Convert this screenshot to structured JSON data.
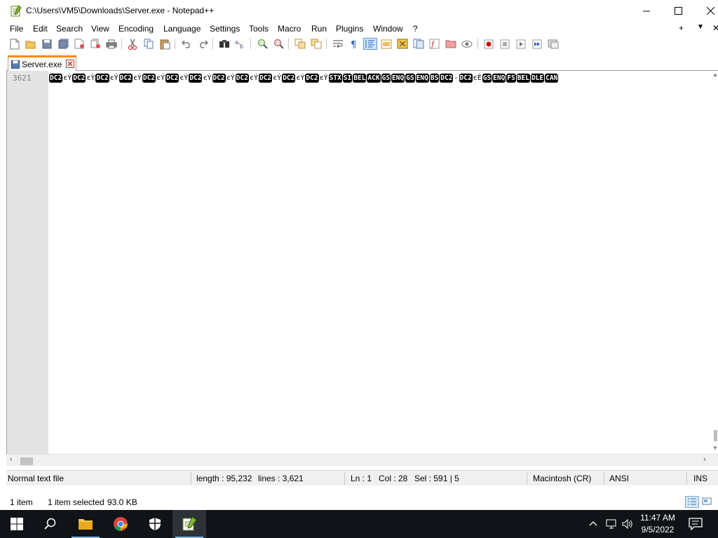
{
  "window": {
    "title": "C:\\Users\\VM5\\Downloads\\Server.exe - Notepad++"
  },
  "menu": {
    "items": [
      "File",
      "Edit",
      "Search",
      "View",
      "Encoding",
      "Language",
      "Settings",
      "Tools",
      "Macro",
      "Run",
      "Plugins",
      "Window",
      "?"
    ],
    "add_tab": "+",
    "tab_list": "▼",
    "close_tab": "✕"
  },
  "tab": {
    "label": "Server.exe"
  },
  "editor": {
    "line_number": "3621",
    "segments": [
      {
        "t": "c",
        "v": "DC2"
      },
      {
        "t": "x",
        "v": "єÝ"
      },
      {
        "t": "c",
        "v": "DC2"
      },
      {
        "t": "x",
        "v": "єÝ"
      },
      {
        "t": "c",
        "v": "DC2"
      },
      {
        "t": "x",
        "v": "єÝ"
      },
      {
        "t": "c",
        "v": "DC2"
      },
      {
        "t": "x",
        "v": "єÝ"
      },
      {
        "t": "c",
        "v": "DC2"
      },
      {
        "t": "x",
        "v": "єÝ"
      },
      {
        "t": "c",
        "v": "DC2"
      },
      {
        "t": "x",
        "v": "єÝ"
      },
      {
        "t": "c",
        "v": "DC2"
      },
      {
        "t": "x",
        "v": "єÝ"
      },
      {
        "t": "c",
        "v": "DC2"
      },
      {
        "t": "x",
        "v": "єÝ"
      },
      {
        "t": "c",
        "v": "DC2"
      },
      {
        "t": "x",
        "v": "єÝ"
      },
      {
        "t": "c",
        "v": "DC2"
      },
      {
        "t": "x",
        "v": "єÝ"
      },
      {
        "t": "c",
        "v": "DC2"
      },
      {
        "t": "x",
        "v": "єÝ"
      },
      {
        "t": "c",
        "v": "DC2"
      },
      {
        "t": "x",
        "v": "єÝ"
      },
      {
        "t": "c",
        "v": "STX"
      },
      {
        "t": "c",
        "v": "SI"
      },
      {
        "t": "c",
        "v": "BEL"
      },
      {
        "t": "c",
        "v": "ACK"
      },
      {
        "t": "c",
        "v": "GS"
      },
      {
        "t": "c",
        "v": "ENQ"
      },
      {
        "t": "c",
        "v": "GS"
      },
      {
        "t": "c",
        "v": "ENQ"
      },
      {
        "t": "c",
        "v": "BS"
      },
      {
        "t": "c",
        "v": "DC2"
      },
      {
        "t": "x",
        "v": "-"
      },
      {
        "t": "c",
        "v": "DC2"
      },
      {
        "t": "x",
        "v": "єÉ"
      },
      {
        "t": "c",
        "v": "GS"
      },
      {
        "t": "c",
        "v": "ENQ"
      },
      {
        "t": "c",
        "v": "FS"
      },
      {
        "t": "c",
        "v": "BEL"
      },
      {
        "t": "c",
        "v": "DLE"
      },
      {
        "t": "c",
        "v": "CAN"
      }
    ]
  },
  "status": {
    "file_type": "Normal text file",
    "length": "length : 95,232",
    "lines": "lines : 3,621",
    "ln": "Ln : 1",
    "col": "Col : 28",
    "sel": "Sel : 591 | 5",
    "eol": "Macintosh (CR)",
    "encoding": "ANSI",
    "mode": "INS"
  },
  "explorer": {
    "items_count": "1 item",
    "selected": "1 item selected",
    "size": "93.0 KB"
  },
  "taskbar": {
    "time": "11:47 AM",
    "date": "9/5/2022"
  },
  "colors": {
    "tab_accent": "#fa8c00",
    "taskbar": "#101418",
    "gutter": "#e4e4e4"
  }
}
